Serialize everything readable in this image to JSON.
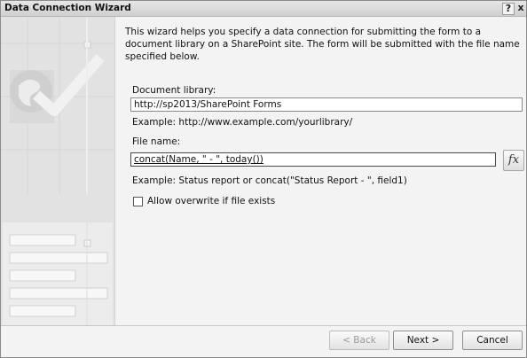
{
  "window": {
    "title": "Data Connection Wizard",
    "help_label": "?",
    "close_label": "x"
  },
  "intro_text": "This wizard helps you specify a data connection for submitting the form to a document library on a SharePoint site. The form will be submitted with the file name specified below.",
  "document_library": {
    "label": "Document library:",
    "value": "http://sp2013/SharePoint Forms",
    "example": "Example: http://www.example.com/yourlibrary/"
  },
  "file_name": {
    "label": "File name:",
    "value": "concat(Name, \" - \", today())",
    "example": "Example: Status report or concat(\"Status Report - \", field1)",
    "fx_label": "fx"
  },
  "overwrite": {
    "label": "Allow overwrite if file exists",
    "checked": false
  },
  "buttons": {
    "back": "< Back",
    "next": "Next >",
    "cancel": "Cancel"
  }
}
